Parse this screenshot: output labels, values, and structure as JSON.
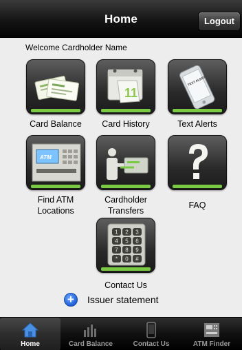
{
  "navbar": {
    "title": "Home",
    "logout_label": "Logout"
  },
  "welcome_text": "Welcome Cardholder Name",
  "tiles": [
    {
      "label": "Card Balance",
      "icon": "card-balance-icon"
    },
    {
      "label": "Card History",
      "icon": "calendar-icon"
    },
    {
      "label": "Text Alerts",
      "icon": "phone-text-alert-icon"
    },
    {
      "label": "Find ATM Locations",
      "icon": "atm-icon"
    },
    {
      "label": "Cardholder Transfers",
      "icon": "transfer-icon"
    },
    {
      "label": "FAQ",
      "icon": "question-icon"
    },
    {
      "label": "Contact Us",
      "icon": "keypad-icon"
    }
  ],
  "icon_text": {
    "alert_sticker": "TEXT ALERT",
    "atm_screen": "ATM",
    "calendar_day": "11"
  },
  "keypad_keys": [
    "1",
    "2",
    "3",
    "4",
    "5",
    "6",
    "7",
    "8",
    "9",
    "*",
    "0",
    "#"
  ],
  "issuer_statement": {
    "label": "Issuer statement",
    "icon": "plus-icon"
  },
  "tabbar": [
    {
      "label": "Home",
      "icon": "home-icon",
      "active": true
    },
    {
      "label": "Card Balance",
      "icon": "bar-chart-icon",
      "active": false
    },
    {
      "label": "Contact Us",
      "icon": "phone-icon",
      "active": false
    },
    {
      "label": "ATM Finder",
      "icon": "atm-finder-icon",
      "active": false
    }
  ],
  "colors": {
    "accent_green": "#79c943",
    "navbar": "#151515",
    "background": "#ededed",
    "tab_active": "#4a90e2"
  }
}
